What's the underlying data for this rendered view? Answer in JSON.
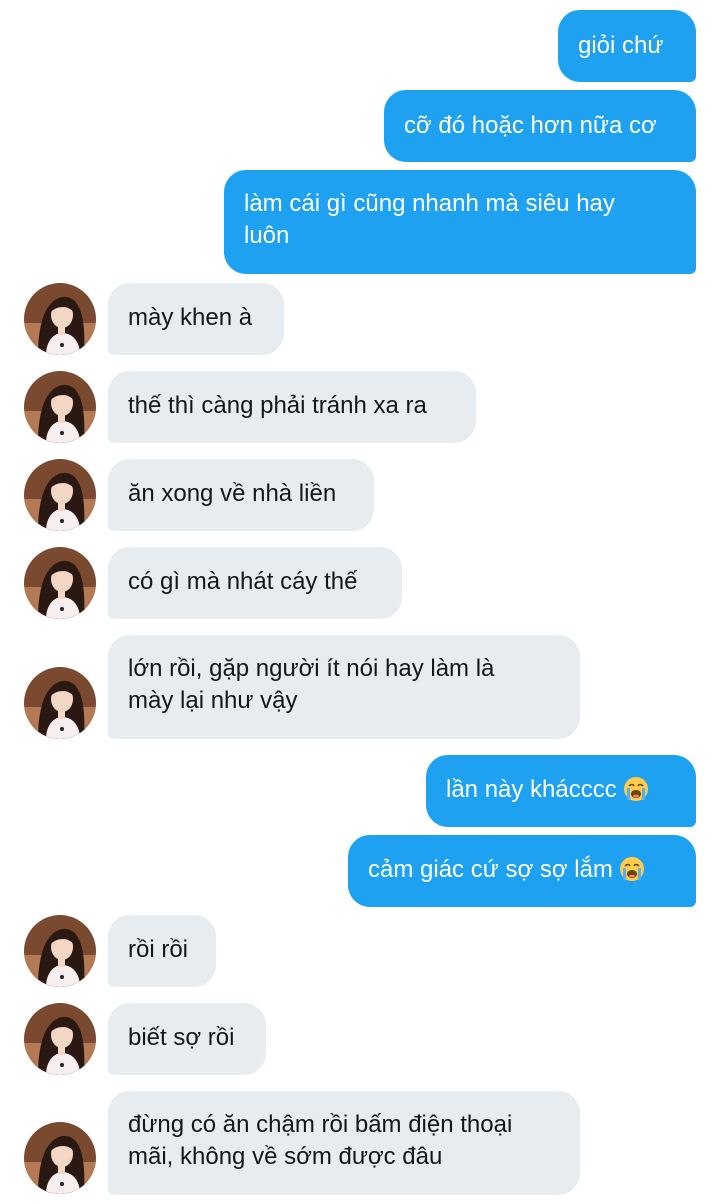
{
  "colors": {
    "outgoing_bubble": "#1ea1f1",
    "incoming_bubble": "#e6ecf0",
    "outgoing_text": "#ffffff",
    "incoming_text": "#14171a"
  },
  "messages": [
    {
      "direction": "out",
      "text": "giỏi chứ"
    },
    {
      "direction": "out",
      "text": "cỡ đó hoặc hơn nữa cơ"
    },
    {
      "direction": "out",
      "line1": "làm cái gì cũng nhanh mà siêu hay",
      "line2": "luôn"
    },
    {
      "direction": "in",
      "text": "mày khen à"
    },
    {
      "direction": "in",
      "text": "thế thì càng phải tránh xa ra"
    },
    {
      "direction": "in",
      "text": "ăn xong về nhà liền"
    },
    {
      "direction": "in",
      "text": "có gì mà nhát cáy thế"
    },
    {
      "direction": "in",
      "line1": "lớn rồi, gặp người ít nói hay làm là",
      "line2": "mày lại như vậy"
    },
    {
      "direction": "out",
      "text": "lần này khácccc",
      "emoji": "loudly-crying-face"
    },
    {
      "direction": "out",
      "text": "cảm giác cứ sợ sợ lắm",
      "emoji": "loudly-crying-face"
    },
    {
      "direction": "in",
      "text": "rồi rồi"
    },
    {
      "direction": "in",
      "text": "biết sợ rồi"
    },
    {
      "direction": "in",
      "line1": "đừng có ăn chậm rồi bấm điện thoại",
      "line2": "mãi, không về sớm được đâu"
    }
  ]
}
